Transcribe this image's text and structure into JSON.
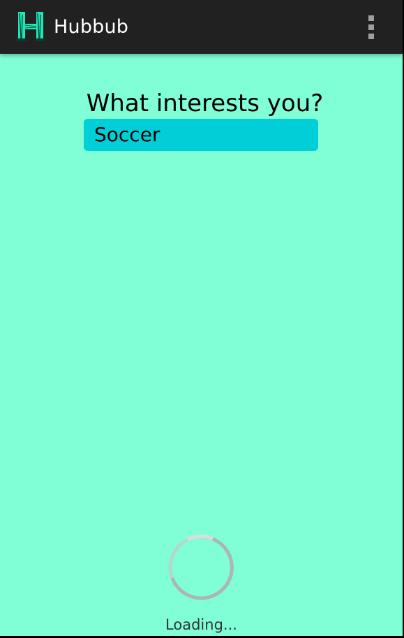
{
  "app": {
    "title": "Hubbub",
    "logo_letter": "H",
    "logo_color": "#1de9b6"
  },
  "header": {
    "overflow_menu_icon": "more-vert-icon"
  },
  "content": {
    "prompt": "What interests you?",
    "selected_interest": "Soccer",
    "background_color": "#80ffd6",
    "chip_color": "#00cfd8"
  },
  "status": {
    "loading_text": "Loading...",
    "spinner_icon": "progress-spinner-icon"
  }
}
